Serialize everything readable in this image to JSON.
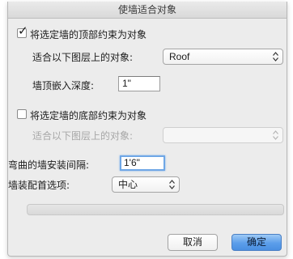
{
  "dialog": {
    "title": "使墙适合对象"
  },
  "top_constraint": {
    "checkbox_label": "将选定墙的顶部约束为对象",
    "checked": true,
    "layer_label": "适合以下图层上的对象:",
    "layer_value": "Roof",
    "embed_label": "墙顶嵌入深度:",
    "embed_value": "1\""
  },
  "bottom_constraint": {
    "checkbox_label": "将选定墙的底部约束为对象",
    "checked": false,
    "layer_label": "适合以下图层上的对象:",
    "layer_value": ""
  },
  "curved_spacing": {
    "label": "弯曲的墙安装间隔:",
    "value": "1'6\""
  },
  "wall_fit": {
    "label": "墙装配首选项:",
    "value": "中心"
  },
  "progress": {
    "fraction": 0
  },
  "buttons": {
    "cancel": "取消",
    "ok": "确定"
  },
  "colors": {
    "accent": "#5b9eea",
    "focus_ring": "#6fa7e6"
  }
}
